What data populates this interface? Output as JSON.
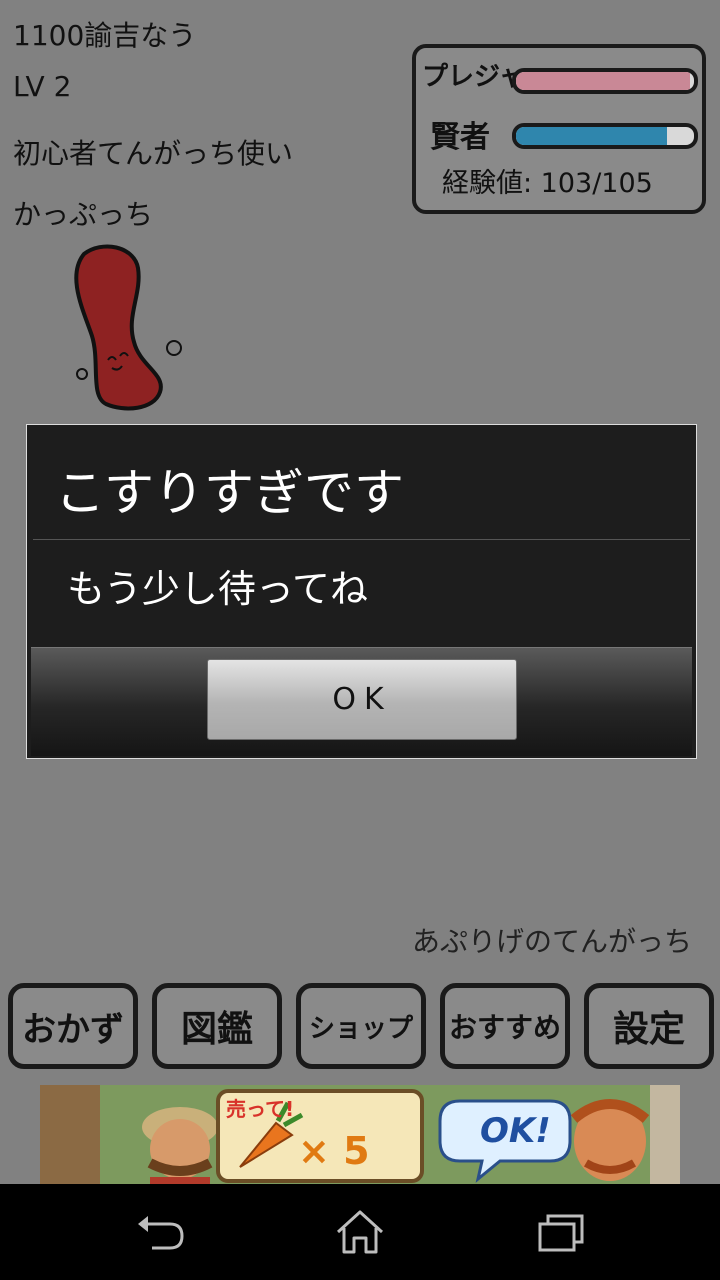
{
  "profile": {
    "line1": "1100諭吉なう",
    "level": "LV 2",
    "title": "初心者てんがっち使い",
    "item": "かっぷっち"
  },
  "status": {
    "pleasure_label": "プレジャー",
    "pleasure_level": 0.98,
    "pleasure_color": "#c98896",
    "sage_label": "賢者",
    "sage_level": 0.85,
    "sage_color": "#2f86ad",
    "exp_text": "経験値: 103/105"
  },
  "dialog": {
    "title": "こすりすぎです",
    "message": "もう少し待ってね",
    "ok_label": "OK"
  },
  "bottom_caption": "あぷりげのてんがっち",
  "menu": {
    "okazu": "おかず",
    "zukan": "図鑑",
    "shop": "ショップ",
    "osusume": "おすすめ",
    "settei": "設定"
  },
  "ad": {
    "sell_text": "売って!",
    "multiplier": "× 5",
    "ok_text": "OK!"
  },
  "nav": {
    "back_icon": "back-icon",
    "home_icon": "home-icon",
    "recents_icon": "recents-icon"
  }
}
